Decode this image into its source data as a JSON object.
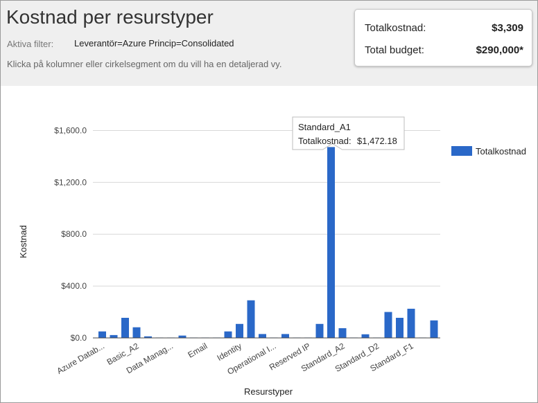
{
  "header": {
    "title": "Kostnad per resurstyper",
    "filter_label": "Aktiva filter:",
    "filter_value": "Leverantör=Azure Princip=Consolidated",
    "hint": "Klicka på kolumner eller cirkelsegment om du vill ha en detaljerad vy."
  },
  "summary": {
    "total_cost_label": "Totalkostnad:",
    "total_cost_value": "$3,309",
    "total_budget_label": "Total budget:",
    "total_budget_value": "$290,000*"
  },
  "colors": {
    "bar": "#2a68c8",
    "header_bg": "#efefef",
    "grid": "#d8d8d8"
  },
  "chart_data": {
    "type": "bar",
    "xlabel": "Resurstyper",
    "ylabel": "Kostnad",
    "ylim": [
      0,
      1800
    ],
    "y_ticks": [
      0,
      400,
      800,
      1200,
      1600
    ],
    "y_tick_labels": [
      "$0.0",
      "$400.0",
      "$800.0",
      "$1,200.0",
      "$1,600.0"
    ],
    "grid": true,
    "legend": "right",
    "x_tick_labels": [
      "Azure Datab...",
      "Basic_A2",
      "Data Manag...",
      "Email",
      "Identity",
      "Operational I...",
      "Reserved IP",
      "Standard_A2",
      "Standard_D2",
      "Standard_F1"
    ],
    "x_tick_indices": [
      0,
      3,
      6,
      9,
      12,
      15,
      18,
      21,
      24,
      27
    ],
    "series": [
      {
        "name": "Totalkostnad",
        "values": [
          50,
          22,
          155,
          82,
          12,
          3,
          3,
          18,
          3,
          3,
          3,
          50,
          108,
          290,
          30,
          3,
          30,
          3,
          3,
          108,
          1472.18,
          75,
          3,
          28,
          3,
          200,
          155,
          225,
          3,
          135
        ]
      }
    ],
    "tooltip": {
      "title": "Standard_A1",
      "label": "Totalkostnad:",
      "value": "$1,472.18"
    }
  }
}
